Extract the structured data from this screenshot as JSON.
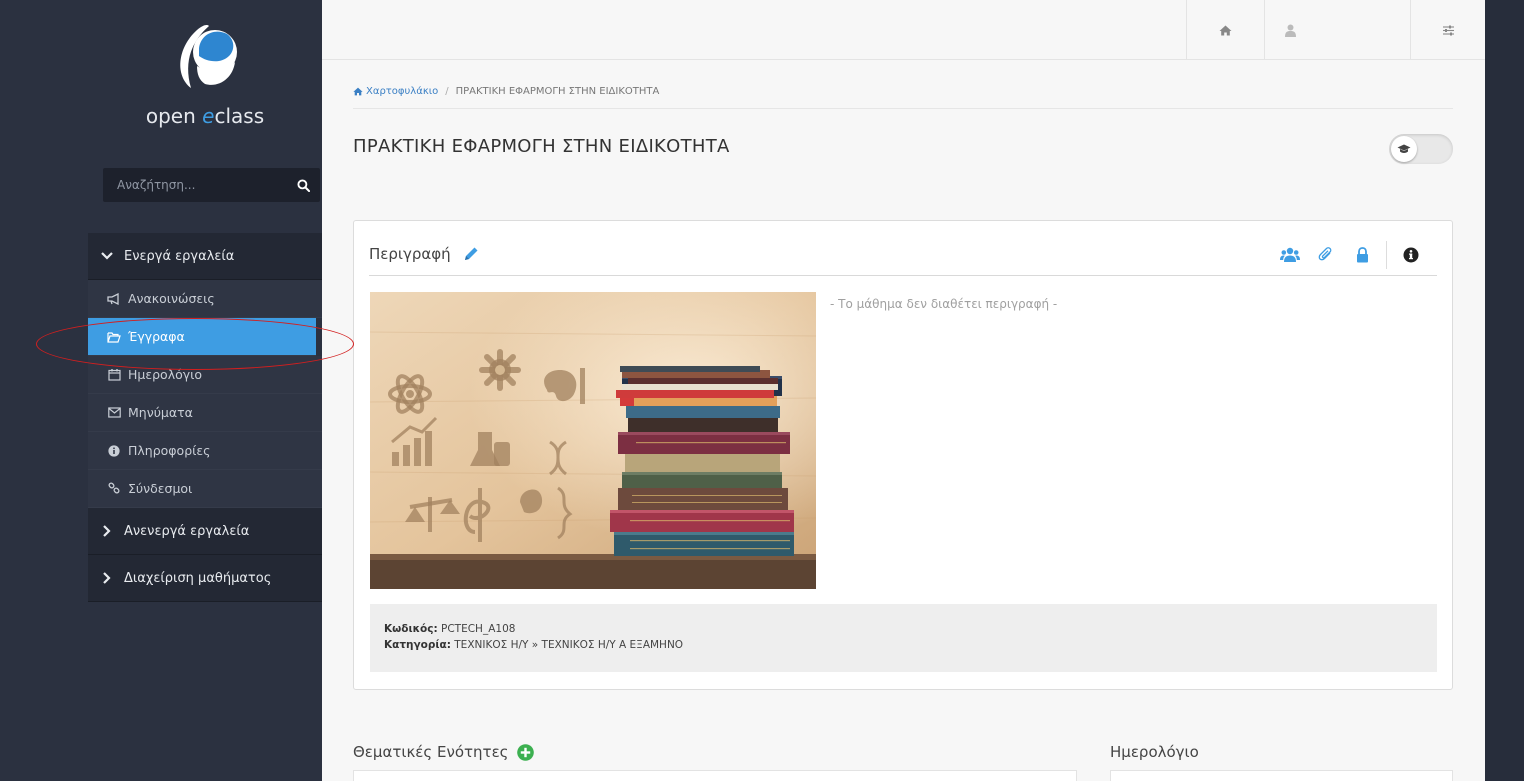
{
  "app": {
    "logo_text_prefix": "open ",
    "logo_text_accent": "e",
    "logo_text_suffix": "class",
    "brand_color": "#3e9de3"
  },
  "search": {
    "placeholder": "Αναζήτηση...",
    "icon": "search-icon"
  },
  "sidebar": {
    "active_group": {
      "label": "Ενεργά εργαλεία",
      "icon": "chevron-down-icon"
    },
    "items": [
      {
        "label": "Ανακοινώσεις",
        "icon": "megaphone-icon",
        "active": false
      },
      {
        "label": "Έγγραφα",
        "icon": "folder-open-icon",
        "active": true
      },
      {
        "label": "Ημερολόγιο",
        "icon": "calendar-icon",
        "active": false
      },
      {
        "label": "Μηνύματα",
        "icon": "envelope-icon",
        "active": false
      },
      {
        "label": "Πληροφορίες",
        "icon": "info-circle-icon",
        "active": false
      },
      {
        "label": "Σύνδεσμοι",
        "icon": "link-icon",
        "active": false
      }
    ],
    "inactive_group": {
      "label": "Ανενεργά εργαλεία",
      "icon": "chevron-right-icon"
    },
    "admin_group": {
      "label": "Διαχείριση μαθήματος",
      "icon": "chevron-right-icon"
    }
  },
  "topbar": {
    "home_icon": "home-icon",
    "user_icon": "user-icon",
    "user_name": "",
    "settings_icon": "sliders-icon"
  },
  "breadcrumb": {
    "home_label": "Χαρτοφυλάκιο",
    "separator": "/",
    "current": "ΠΡΑΚΤΙΚΗ ΕΦΑΡΜΟΓΗ ΣΤΗΝ ΕΙΔΙΚΟΤΗΤΑ"
  },
  "page": {
    "title": "ΠΡΑΚΤΙΚΗ ΕΦΑΡΜΟΓΗ ΣΤΗΝ ΕΙΔΙΚΟΤΗΤΑ",
    "toggle_icon": "graduation-cap-icon"
  },
  "description_panel": {
    "title": "Περιγραφή",
    "edit_icon": "pencil-icon",
    "icons": [
      "users-icon",
      "paperclip-icon",
      "lock-icon",
      "info-circle-icon"
    ],
    "no_description": "- Το μάθημα δεν διαθέτει περιγραφή -",
    "code_label": "Κωδικός:",
    "code_value": "PCTECH_A108",
    "category_label": "Κατηγορία:",
    "category_value": "ΤΕΧΝΙΚΟΣ Η/Υ » ΤΕΧΝΙΚΟΣ Η/Υ Α ΕΞΑΜΗΝΟ"
  },
  "sections": {
    "units_title": "Θεματικές Ενότητες",
    "units_add_icon": "plus-circle-icon",
    "calendar_title": "Ημερολόγιο"
  }
}
